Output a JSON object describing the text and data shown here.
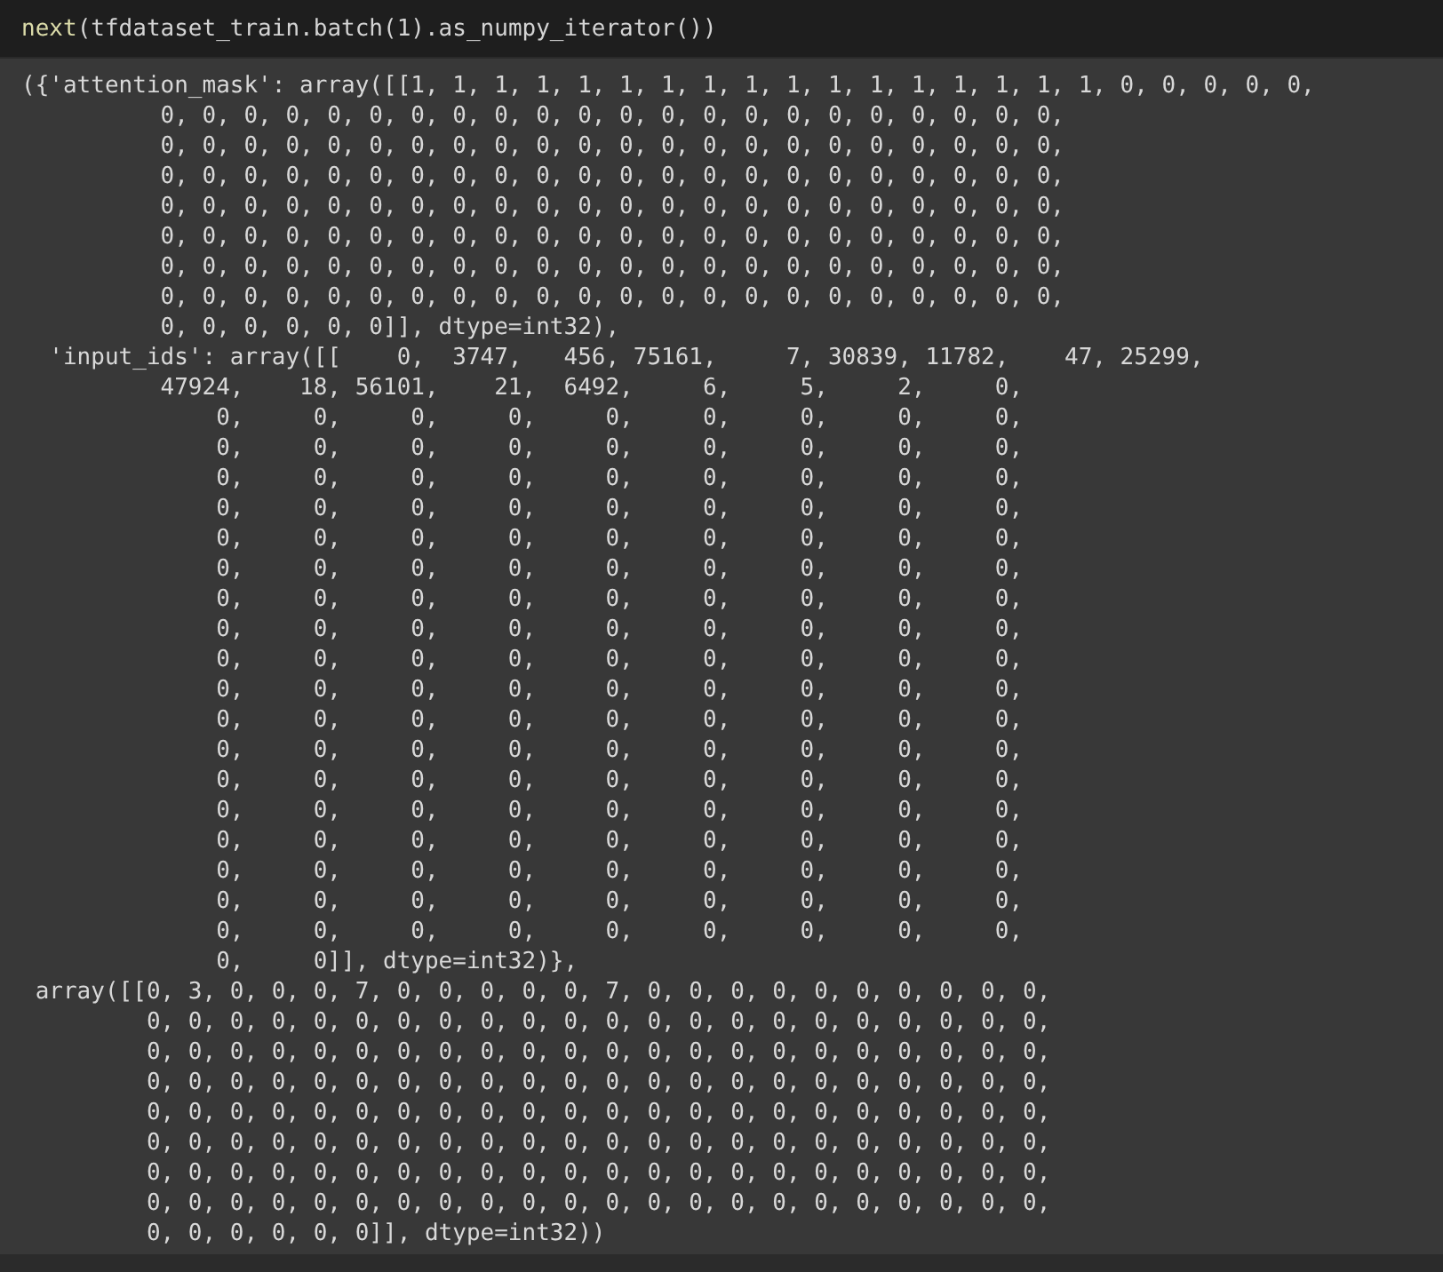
{
  "code_cell": {
    "tokens": [
      {
        "kind": "function",
        "text": "next"
      },
      {
        "kind": "plain",
        "text": "(tfdataset_train.batch(1).as_numpy_iterator())"
      }
    ]
  },
  "output": {
    "lines": [
      "({'attention_mask': array([[1, 1, 1, 1, 1, 1, 1, 1, 1, 1, 1, 1, 1, 1, 1, 1, 1, 0, 0, 0, 0, 0,",
      "          0, 0, 0, 0, 0, 0, 0, 0, 0, 0, 0, 0, 0, 0, 0, 0, 0, 0, 0, 0, 0, 0,",
      "          0, 0, 0, 0, 0, 0, 0, 0, 0, 0, 0, 0, 0, 0, 0, 0, 0, 0, 0, 0, 0, 0,",
      "          0, 0, 0, 0, 0, 0, 0, 0, 0, 0, 0, 0, 0, 0, 0, 0, 0, 0, 0, 0, 0, 0,",
      "          0, 0, 0, 0, 0, 0, 0, 0, 0, 0, 0, 0, 0, 0, 0, 0, 0, 0, 0, 0, 0, 0,",
      "          0, 0, 0, 0, 0, 0, 0, 0, 0, 0, 0, 0, 0, 0, 0, 0, 0, 0, 0, 0, 0, 0,",
      "          0, 0, 0, 0, 0, 0, 0, 0, 0, 0, 0, 0, 0, 0, 0, 0, 0, 0, 0, 0, 0, 0,",
      "          0, 0, 0, 0, 0, 0, 0, 0, 0, 0, 0, 0, 0, 0, 0, 0, 0, 0, 0, 0, 0, 0,",
      "          0, 0, 0, 0, 0, 0]], dtype=int32),",
      "  'input_ids': array([[    0,  3747,   456, 75161,     7, 30839, 11782,    47, 25299,",
      "          47924,    18, 56101,    21,  6492,     6,     5,     2,     0,",
      "              0,     0,     0,     0,     0,     0,     0,     0,     0,",
      "              0,     0,     0,     0,     0,     0,     0,     0,     0,",
      "              0,     0,     0,     0,     0,     0,     0,     0,     0,",
      "              0,     0,     0,     0,     0,     0,     0,     0,     0,",
      "              0,     0,     0,     0,     0,     0,     0,     0,     0,",
      "              0,     0,     0,     0,     0,     0,     0,     0,     0,",
      "              0,     0,     0,     0,     0,     0,     0,     0,     0,",
      "              0,     0,     0,     0,     0,     0,     0,     0,     0,",
      "              0,     0,     0,     0,     0,     0,     0,     0,     0,",
      "              0,     0,     0,     0,     0,     0,     0,     0,     0,",
      "              0,     0,     0,     0,     0,     0,     0,     0,     0,",
      "              0,     0,     0,     0,     0,     0,     0,     0,     0,",
      "              0,     0,     0,     0,     0,     0,     0,     0,     0,",
      "              0,     0,     0,     0,     0,     0,     0,     0,     0,",
      "              0,     0,     0,     0,     0,     0,     0,     0,     0,",
      "              0,     0,     0,     0,     0,     0,     0,     0,     0,",
      "              0,     0,     0,     0,     0,     0,     0,     0,     0,",
      "              0,     0,     0,     0,     0,     0,     0,     0,     0,",
      "              0,     0]], dtype=int32)},",
      " array([[0, 3, 0, 0, 0, 7, 0, 0, 0, 0, 0, 7, 0, 0, 0, 0, 0, 0, 0, 0, 0, 0,",
      "         0, 0, 0, 0, 0, 0, 0, 0, 0, 0, 0, 0, 0, 0, 0, 0, 0, 0, 0, 0, 0, 0,",
      "         0, 0, 0, 0, 0, 0, 0, 0, 0, 0, 0, 0, 0, 0, 0, 0, 0, 0, 0, 0, 0, 0,",
      "         0, 0, 0, 0, 0, 0, 0, 0, 0, 0, 0, 0, 0, 0, 0, 0, 0, 0, 0, 0, 0, 0,",
      "         0, 0, 0, 0, 0, 0, 0, 0, 0, 0, 0, 0, 0, 0, 0, 0, 0, 0, 0, 0, 0, 0,",
      "         0, 0, 0, 0, 0, 0, 0, 0, 0, 0, 0, 0, 0, 0, 0, 0, 0, 0, 0, 0, 0, 0,",
      "         0, 0, 0, 0, 0, 0, 0, 0, 0, 0, 0, 0, 0, 0, 0, 0, 0, 0, 0, 0, 0, 0,",
      "         0, 0, 0, 0, 0, 0, 0, 0, 0, 0, 0, 0, 0, 0, 0, 0, 0, 0, 0, 0, 0, 0,",
      "         0, 0, 0, 0, 0, 0]], dtype=int32))"
    ]
  }
}
